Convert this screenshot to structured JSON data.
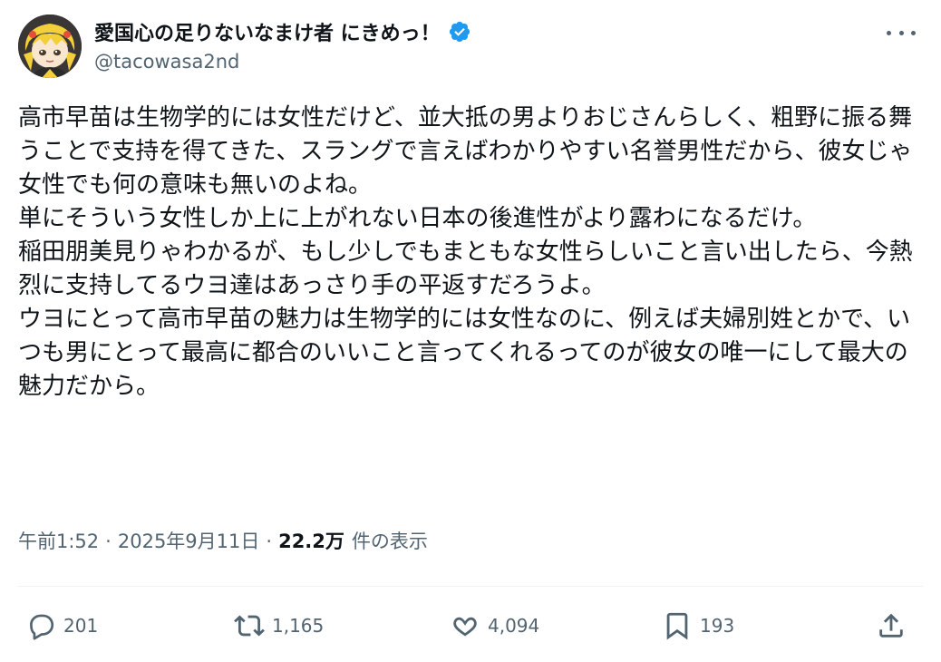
{
  "author": {
    "display_name": "愛国心の足りないなまけ者 にきめっ！",
    "handle": "@tacowasa2nd",
    "verified": true,
    "avatar_icon": "anime-character-avatar"
  },
  "post": {
    "text": "高市早苗は生物学的には女性だけど、並大抵の男よりおじさんらしく、粗野に振る舞うことで支持を得てきた、スラングで言えばわかりやすい名誉男性だから、彼女じゃ女性でも何の意味も無いのよね。\n単にそういう女性しか上に上がれない日本の後進性がより露わになるだけ。\n稲田朋美見りゃわかるが、もし少しでもまともな女性らしいこと言い出したら、今熱烈に支持してるウヨ達はあっさり手の平返すだろうよ。\nウヨにとって高市早苗の魅力は生物学的には女性なのに、例えば夫婦別姓とかで、いつも男にとって最高に都合のいいこと言ってくれるってのが彼女の唯一にして最大の魅力だから。"
  },
  "meta": {
    "time": "午前1:52",
    "separator": "·",
    "date": "2025年9月11日",
    "views_count": "22.2万",
    "views_label": "件の表示"
  },
  "actions": {
    "replies": "201",
    "reposts": "1,165",
    "likes": "4,094",
    "bookmarks": "193"
  },
  "colors": {
    "text_primary": "#0f1419",
    "text_secondary": "#536471",
    "verified_blue": "#1d9bf0",
    "divider": "#eff3f4"
  }
}
